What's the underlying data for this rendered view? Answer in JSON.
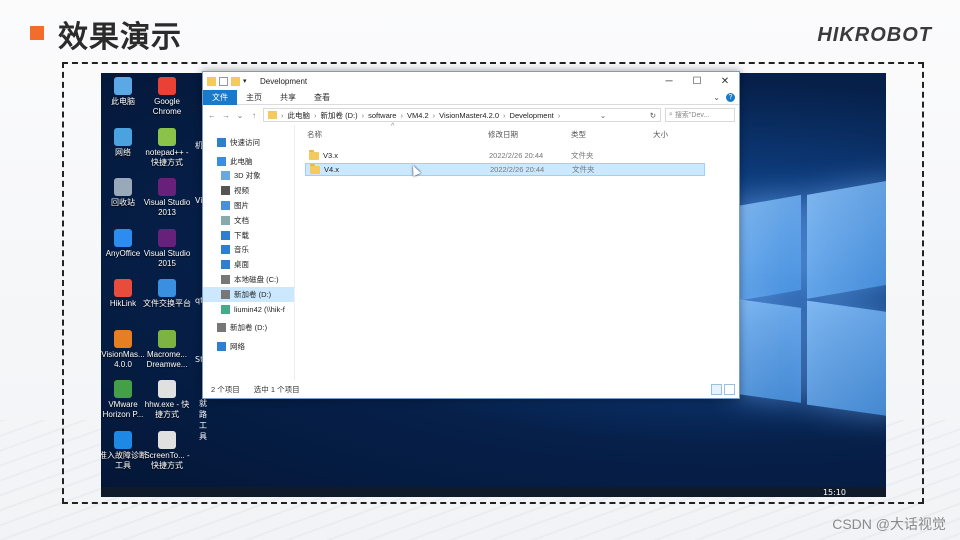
{
  "slide": {
    "title": "效果演示",
    "brand": "HIKROBOT",
    "watermark": "CSDN @大话视觉",
    "accent": "#f26c2b"
  },
  "desktop": {
    "icons": [
      {
        "label": "此电脑",
        "icon": "computer-icon",
        "color": "#5aa9e6"
      },
      {
        "label": "Google Chrome",
        "icon": "chrome-icon",
        "color": "#e94235"
      },
      {
        "label": "网络",
        "icon": "network-icon",
        "color": "#4aa3df"
      },
      {
        "label": "notepad++ - 快捷方式",
        "icon": "notepad-icon",
        "color": "#8bc34a"
      },
      {
        "label": "回收站",
        "icon": "recycle-bin-icon",
        "color": "#9aa9b9"
      },
      {
        "label": "Visual Studio 2013",
        "icon": "visual-studio-icon",
        "color": "#68217a"
      },
      {
        "label": "AnyOffice",
        "icon": "anyoffice-icon",
        "color": "#2d8cf0"
      },
      {
        "label": "Visual Studio 2015",
        "icon": "visual-studio-icon",
        "color": "#68217a"
      },
      {
        "label": "HikLink",
        "icon": "hiklink-icon",
        "color": "#e84c3d"
      },
      {
        "label": "文件交换平台",
        "icon": "file-exchange-icon",
        "color": "#3b8fe0"
      },
      {
        "label": "VisionMas... 4.0.0",
        "icon": "visionmaster-icon",
        "color": "#e67e22"
      },
      {
        "label": "Macrome... Dreamwe...",
        "icon": "dreamweaver-icon",
        "color": "#7cb342"
      },
      {
        "label": "VMware Horizon P...",
        "icon": "vmware-icon",
        "color": "#43a047"
      },
      {
        "label": "hhw.exe - 快捷方式",
        "icon": "hhw-icon",
        "color": "#e0e0e0"
      },
      {
        "label": "准入故障诊断工具",
        "icon": "shield-icon",
        "color": "#1e88e5"
      },
      {
        "label": "ScreenTo... - 快捷方式",
        "icon": "screen-icon",
        "color": "#e0e0e0"
      }
    ],
    "partial_labels": [
      "机",
      "Vi",
      "qt",
      "Stu",
      "就路工具"
    ],
    "clock": "15:10"
  },
  "explorer": {
    "title": "Development",
    "ribbon_tabs": [
      "文件",
      "主页",
      "共享",
      "查看"
    ],
    "address": [
      "此电脑",
      "新加卷 (D:)",
      "software",
      "VM4.2",
      "VisionMaster4.2.0",
      "Development"
    ],
    "search_placeholder": "搜索\"Dev...",
    "nav_items": [
      {
        "label": "快速访问",
        "icon": "star-icon",
        "indent": 0
      },
      {
        "label": "此电脑",
        "icon": "computer-icon",
        "indent": 0
      },
      {
        "label": "3D 对象",
        "icon": "cube-icon",
        "indent": 1
      },
      {
        "label": "视频",
        "icon": "video-icon",
        "indent": 1
      },
      {
        "label": "图片",
        "icon": "picture-icon",
        "indent": 1
      },
      {
        "label": "文档",
        "icon": "document-icon",
        "indent": 1
      },
      {
        "label": "下载",
        "icon": "download-icon",
        "indent": 1
      },
      {
        "label": "音乐",
        "icon": "music-icon",
        "indent": 1
      },
      {
        "label": "桌面",
        "icon": "desktop-icon",
        "indent": 1
      },
      {
        "label": "本地磁盘 (C:)",
        "icon": "drive-icon",
        "indent": 1
      },
      {
        "label": "新加卷 (D:)",
        "icon": "drive-icon",
        "indent": 1,
        "selected": true
      },
      {
        "label": "liumin42 (\\\\hik-f",
        "icon": "network-drive-icon",
        "indent": 1
      },
      {
        "label": "新加卷 (D:)",
        "icon": "drive-icon",
        "indent": 0
      },
      {
        "label": "网络",
        "icon": "network-icon",
        "indent": 0
      }
    ],
    "columns": [
      "名称",
      "修改日期",
      "类型",
      "大小"
    ],
    "rows": [
      {
        "name": "V3.x",
        "date": "2022/2/26 20:44",
        "type": "文件夹",
        "selected": false
      },
      {
        "name": "V4.x",
        "date": "2022/2/26 20:44",
        "type": "文件夹",
        "selected": true
      }
    ],
    "status_count": "2 个项目",
    "status_selected": "选中 1 个项目"
  }
}
